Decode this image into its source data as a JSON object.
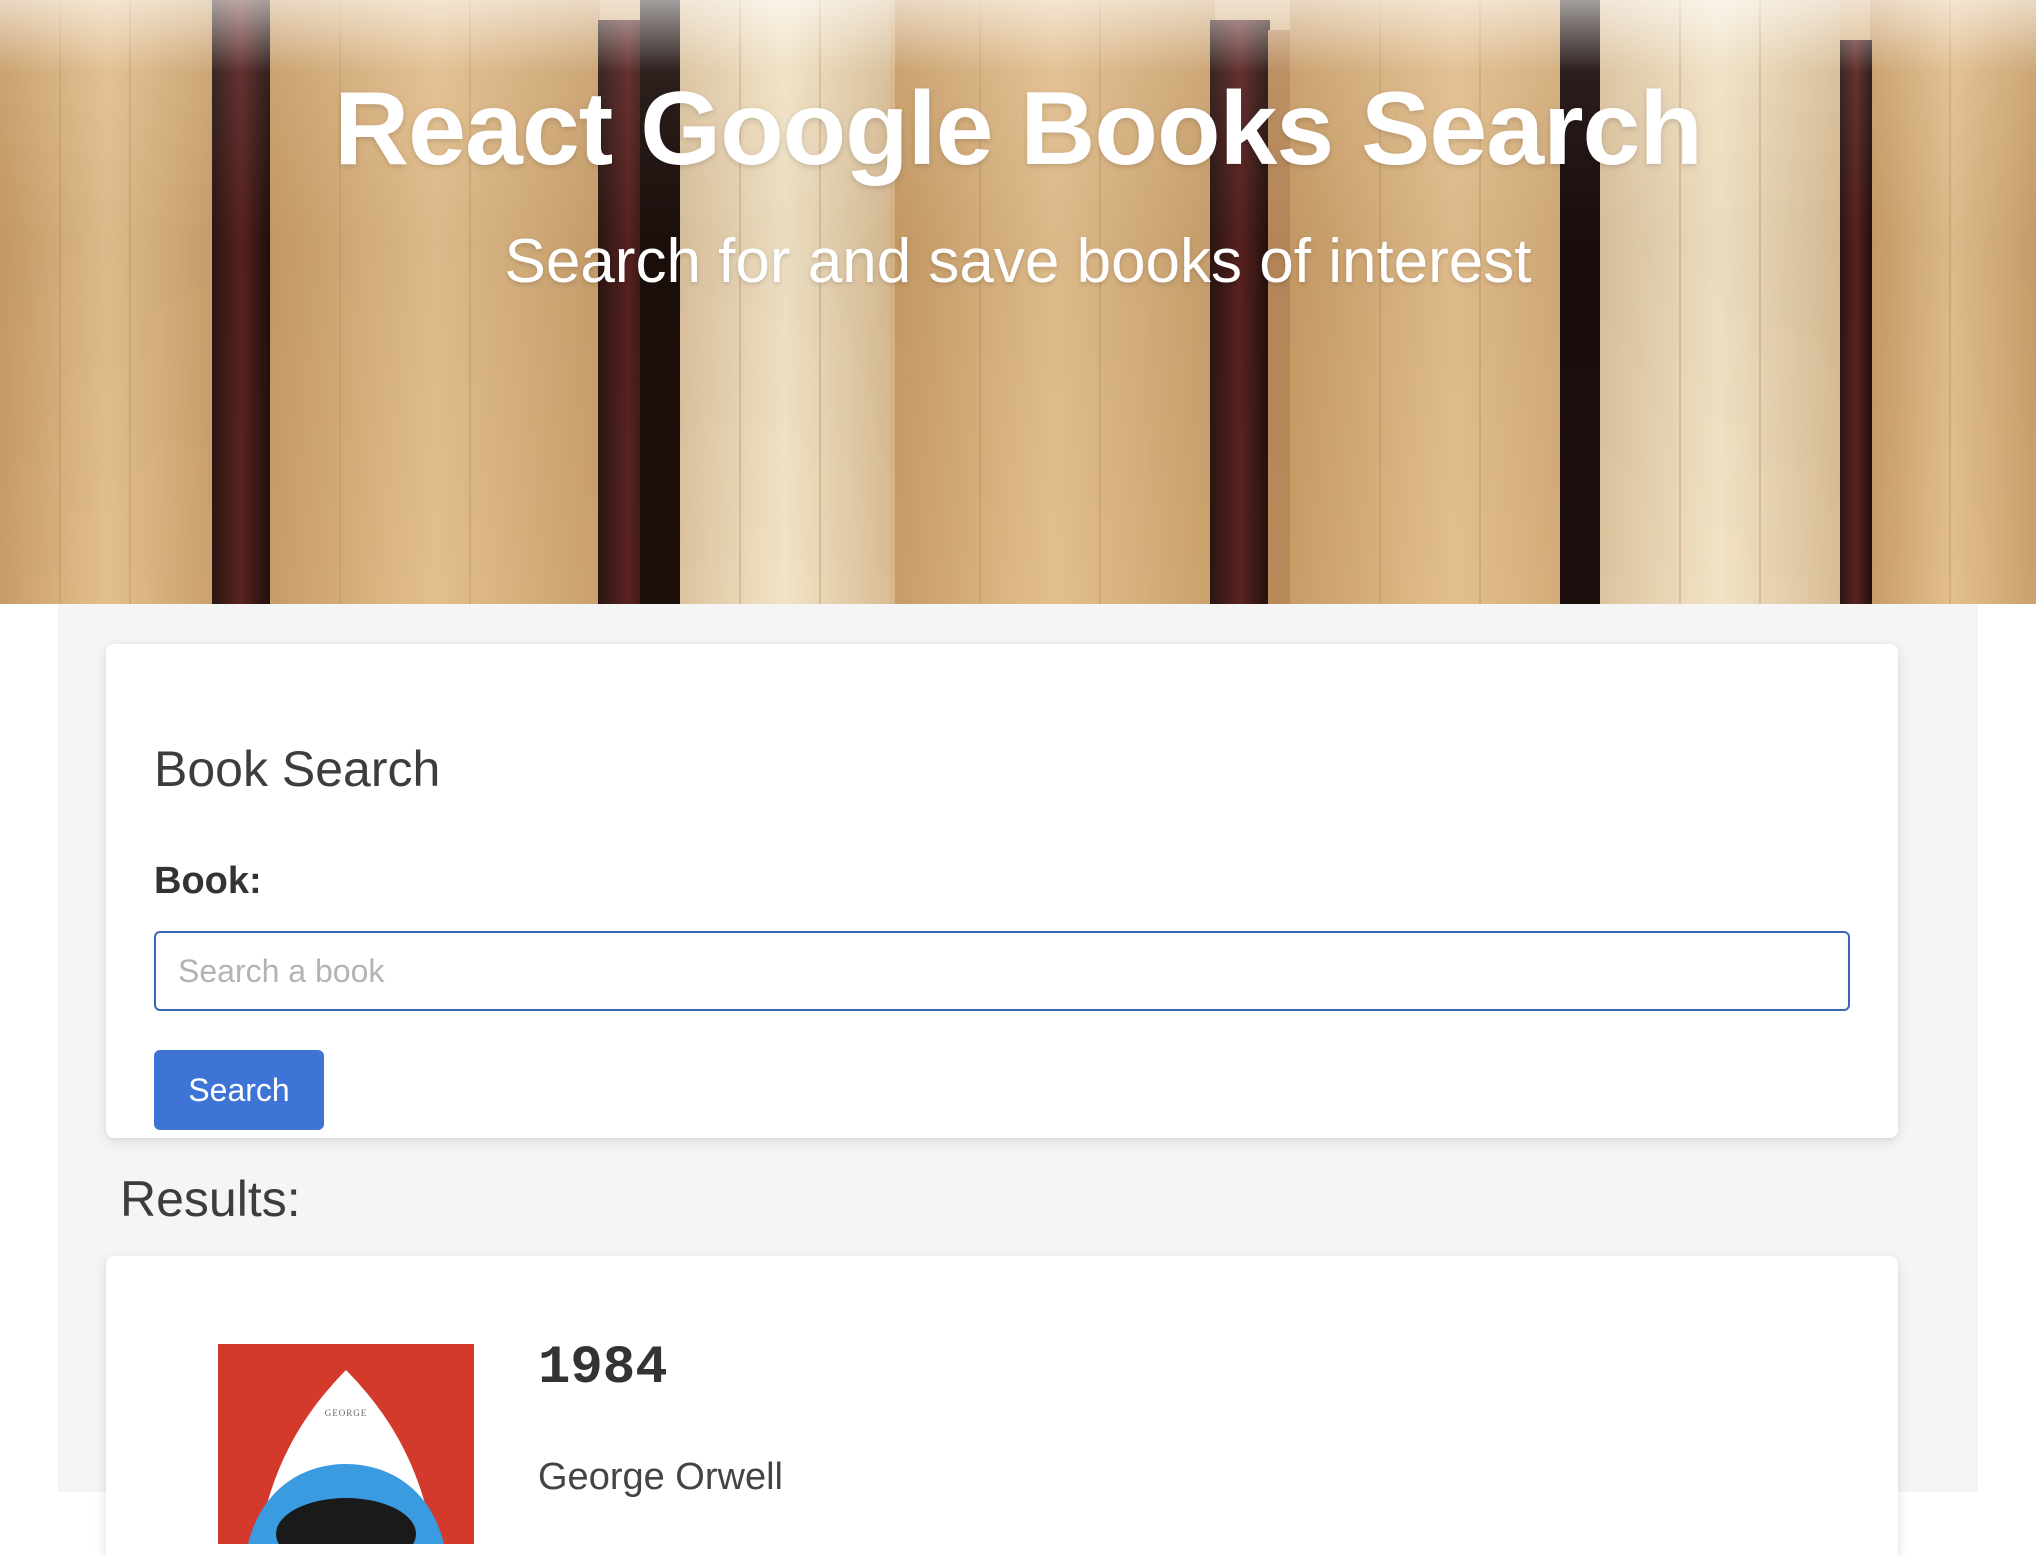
{
  "hero": {
    "title": "React Google Books Search",
    "subtitle": "Search for and save books of interest"
  },
  "search_card": {
    "title": "Book Search",
    "field_label": "Book:",
    "input_value": "",
    "input_placeholder": "Search a book",
    "button_label": "Search"
  },
  "results": {
    "heading": "Results:",
    "items": [
      {
        "title": "1984",
        "author": "George Orwell",
        "cover_text": "GEORGE"
      }
    ]
  },
  "colors": {
    "accent": "#3d74d6",
    "input_border": "#3a66b7",
    "page_bg": "#f5f5f5",
    "cover_red": "#d33a2c",
    "cover_blue": "#3b9be0"
  }
}
